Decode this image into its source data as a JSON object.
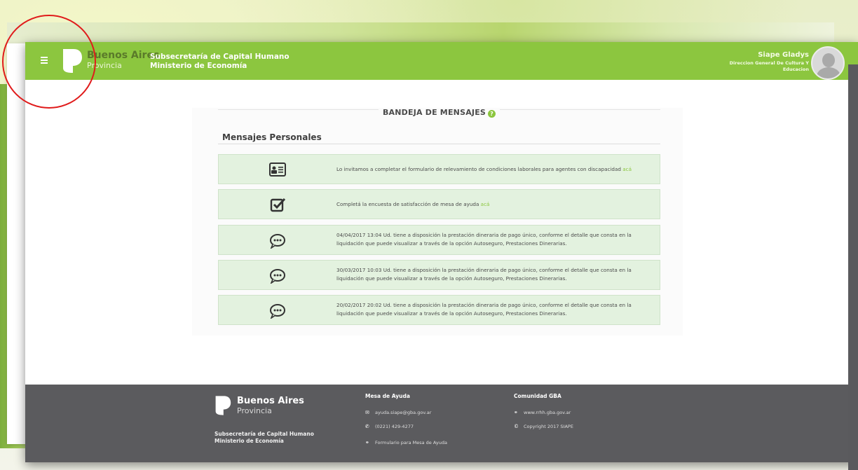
{
  "header": {
    "brand_name": "Buenos Aires",
    "brand_sub": "Provincia",
    "org_line1": "Subsecretaría de Capital Humano",
    "org_line2": "Ministerio de Economía",
    "user_name": "Siape Gladys",
    "user_dept": "Direccion General De Cultura Y Educacion"
  },
  "main": {
    "title": "BANDEJA DE MENSAJES",
    "subtitle": "Mensajes Personales",
    "messages": [
      {
        "icon": "id-card-icon",
        "text": "Lo invitamos a completar el formulario de relevamiento de condiciones laborales para agentes con discapacidad ",
        "link": "acá"
      },
      {
        "icon": "checkbox-icon",
        "text": "Completá la encuesta de satisfacción de mesa de ayuda ",
        "link": "acá"
      },
      {
        "icon": "speech-bubble-icon",
        "text": "04/04/2017 13:04 Ud. tiene a disposición la prestación dineraria de pago único, conforme el detalle que consta en la liquidación que puede visualizar a través de la opción Autoseguro, Prestaciones Dinerarias."
      },
      {
        "icon": "speech-bubble-icon",
        "text": "30/03/2017 10:03 Ud. tiene a disposición la prestación dineraria de pago único, conforme el detalle que consta en la liquidación que puede visualizar a través de la opción Autoseguro, Prestaciones Dinerarias."
      },
      {
        "icon": "speech-bubble-icon",
        "text": "20/02/2017 20:02 Ud. tiene a disposición la prestación dineraria de pago único, conforme el detalle que consta en la liquidación que puede visualizar a través de la opción Autoseguro, Prestaciones Dinerarias."
      }
    ]
  },
  "footer": {
    "brand_name": "Buenos Aires",
    "brand_sub": "Provincia",
    "org_line1": "Subsecretaría de Capital Humano",
    "org_line2": "Ministerio de Economía",
    "help_title": "Mesa de Ayuda",
    "help_email": "ayuda.siape@gba.gov.ar",
    "help_phone": "(0221) 429-4277",
    "help_form": "Formulario para Mesa de Ayuda",
    "community_title": "Comunidad GBA",
    "community_link": "www.rrhh.gba.gov.ar",
    "copyright": "Copyright 2017 SIAPE"
  },
  "colors": {
    "accent": "#8cc63f",
    "footer": "#5b5b5e",
    "message_bg": "#e3f2df"
  }
}
